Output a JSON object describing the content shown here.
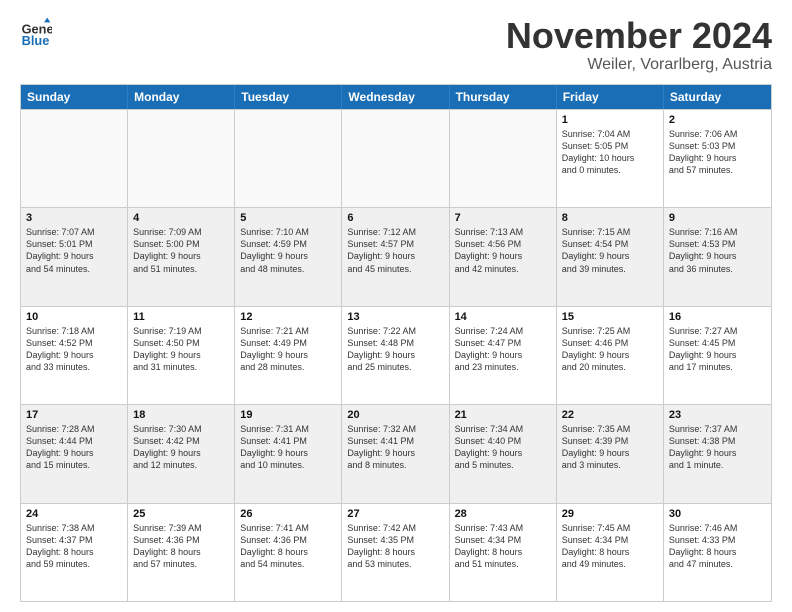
{
  "logo": {
    "line1": "General",
    "line2": "Blue"
  },
  "header": {
    "month": "November 2024",
    "location": "Weiler, Vorarlberg, Austria"
  },
  "days_of_week": [
    "Sunday",
    "Monday",
    "Tuesday",
    "Wednesday",
    "Thursday",
    "Friday",
    "Saturday"
  ],
  "rows": [
    [
      {
        "day": "",
        "info": "",
        "empty": true
      },
      {
        "day": "",
        "info": "",
        "empty": true
      },
      {
        "day": "",
        "info": "",
        "empty": true
      },
      {
        "day": "",
        "info": "",
        "empty": true
      },
      {
        "day": "",
        "info": "",
        "empty": true
      },
      {
        "day": "1",
        "info": "Sunrise: 7:04 AM\nSunset: 5:05 PM\nDaylight: 10 hours\nand 0 minutes.",
        "empty": false
      },
      {
        "day": "2",
        "info": "Sunrise: 7:06 AM\nSunset: 5:03 PM\nDaylight: 9 hours\nand 57 minutes.",
        "empty": false
      }
    ],
    [
      {
        "day": "3",
        "info": "Sunrise: 7:07 AM\nSunset: 5:01 PM\nDaylight: 9 hours\nand 54 minutes.",
        "empty": false
      },
      {
        "day": "4",
        "info": "Sunrise: 7:09 AM\nSunset: 5:00 PM\nDaylight: 9 hours\nand 51 minutes.",
        "empty": false
      },
      {
        "day": "5",
        "info": "Sunrise: 7:10 AM\nSunset: 4:59 PM\nDaylight: 9 hours\nand 48 minutes.",
        "empty": false
      },
      {
        "day": "6",
        "info": "Sunrise: 7:12 AM\nSunset: 4:57 PM\nDaylight: 9 hours\nand 45 minutes.",
        "empty": false
      },
      {
        "day": "7",
        "info": "Sunrise: 7:13 AM\nSunset: 4:56 PM\nDaylight: 9 hours\nand 42 minutes.",
        "empty": false
      },
      {
        "day": "8",
        "info": "Sunrise: 7:15 AM\nSunset: 4:54 PM\nDaylight: 9 hours\nand 39 minutes.",
        "empty": false
      },
      {
        "day": "9",
        "info": "Sunrise: 7:16 AM\nSunset: 4:53 PM\nDaylight: 9 hours\nand 36 minutes.",
        "empty": false
      }
    ],
    [
      {
        "day": "10",
        "info": "Sunrise: 7:18 AM\nSunset: 4:52 PM\nDaylight: 9 hours\nand 33 minutes.",
        "empty": false
      },
      {
        "day": "11",
        "info": "Sunrise: 7:19 AM\nSunset: 4:50 PM\nDaylight: 9 hours\nand 31 minutes.",
        "empty": false
      },
      {
        "day": "12",
        "info": "Sunrise: 7:21 AM\nSunset: 4:49 PM\nDaylight: 9 hours\nand 28 minutes.",
        "empty": false
      },
      {
        "day": "13",
        "info": "Sunrise: 7:22 AM\nSunset: 4:48 PM\nDaylight: 9 hours\nand 25 minutes.",
        "empty": false
      },
      {
        "day": "14",
        "info": "Sunrise: 7:24 AM\nSunset: 4:47 PM\nDaylight: 9 hours\nand 23 minutes.",
        "empty": false
      },
      {
        "day": "15",
        "info": "Sunrise: 7:25 AM\nSunset: 4:46 PM\nDaylight: 9 hours\nand 20 minutes.",
        "empty": false
      },
      {
        "day": "16",
        "info": "Sunrise: 7:27 AM\nSunset: 4:45 PM\nDaylight: 9 hours\nand 17 minutes.",
        "empty": false
      }
    ],
    [
      {
        "day": "17",
        "info": "Sunrise: 7:28 AM\nSunset: 4:44 PM\nDaylight: 9 hours\nand 15 minutes.",
        "empty": false
      },
      {
        "day": "18",
        "info": "Sunrise: 7:30 AM\nSunset: 4:42 PM\nDaylight: 9 hours\nand 12 minutes.",
        "empty": false
      },
      {
        "day": "19",
        "info": "Sunrise: 7:31 AM\nSunset: 4:41 PM\nDaylight: 9 hours\nand 10 minutes.",
        "empty": false
      },
      {
        "day": "20",
        "info": "Sunrise: 7:32 AM\nSunset: 4:41 PM\nDaylight: 9 hours\nand 8 minutes.",
        "empty": false
      },
      {
        "day": "21",
        "info": "Sunrise: 7:34 AM\nSunset: 4:40 PM\nDaylight: 9 hours\nand 5 minutes.",
        "empty": false
      },
      {
        "day": "22",
        "info": "Sunrise: 7:35 AM\nSunset: 4:39 PM\nDaylight: 9 hours\nand 3 minutes.",
        "empty": false
      },
      {
        "day": "23",
        "info": "Sunrise: 7:37 AM\nSunset: 4:38 PM\nDaylight: 9 hours\nand 1 minute.",
        "empty": false
      }
    ],
    [
      {
        "day": "24",
        "info": "Sunrise: 7:38 AM\nSunset: 4:37 PM\nDaylight: 8 hours\nand 59 minutes.",
        "empty": false
      },
      {
        "day": "25",
        "info": "Sunrise: 7:39 AM\nSunset: 4:36 PM\nDaylight: 8 hours\nand 57 minutes.",
        "empty": false
      },
      {
        "day": "26",
        "info": "Sunrise: 7:41 AM\nSunset: 4:36 PM\nDaylight: 8 hours\nand 54 minutes.",
        "empty": false
      },
      {
        "day": "27",
        "info": "Sunrise: 7:42 AM\nSunset: 4:35 PM\nDaylight: 8 hours\nand 53 minutes.",
        "empty": false
      },
      {
        "day": "28",
        "info": "Sunrise: 7:43 AM\nSunset: 4:34 PM\nDaylight: 8 hours\nand 51 minutes.",
        "empty": false
      },
      {
        "day": "29",
        "info": "Sunrise: 7:45 AM\nSunset: 4:34 PM\nDaylight: 8 hours\nand 49 minutes.",
        "empty": false
      },
      {
        "day": "30",
        "info": "Sunrise: 7:46 AM\nSunset: 4:33 PM\nDaylight: 8 hours\nand 47 minutes.",
        "empty": false
      }
    ]
  ]
}
